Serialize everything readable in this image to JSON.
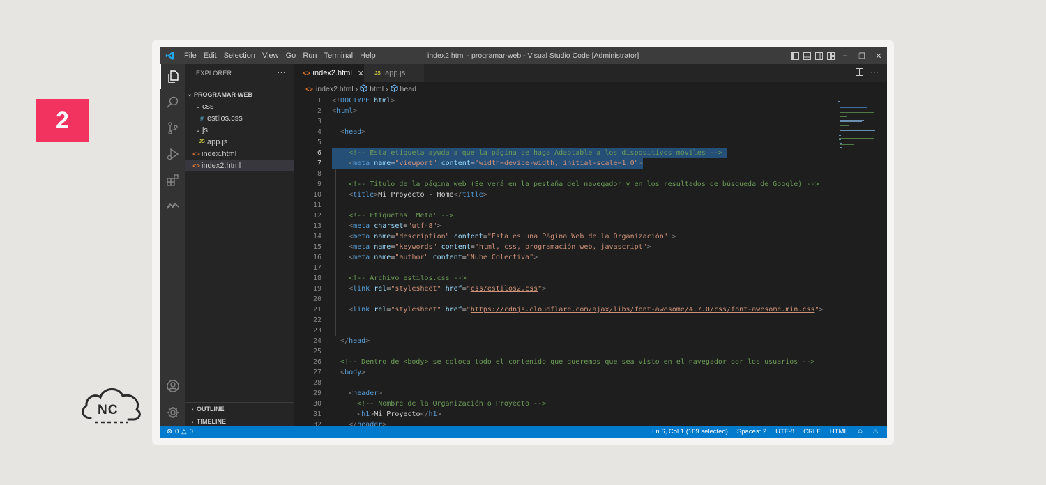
{
  "badge": "2",
  "logo_text": "NC",
  "window": {
    "title": "index2.html - programar-web - Visual Studio Code [Administrator]",
    "menu": [
      "File",
      "Edit",
      "Selection",
      "View",
      "Go",
      "Run",
      "Terminal",
      "Help"
    ]
  },
  "sidebar": {
    "header": "EXPLORER",
    "project": "PROGRAMAR-WEB",
    "folders": {
      "css": "css",
      "css_file": "estilos.css",
      "js": "js",
      "js_file": "app.js",
      "file1": "index.html",
      "file2": "index2.html"
    },
    "outline": "OUTLINE",
    "timeline": "TIMELINE",
    "icons": {
      "css": "#",
      "js": "JS",
      "html": "<>"
    }
  },
  "tabs": [
    {
      "label": "index2.html",
      "icon": "html-file-icon",
      "active": true
    },
    {
      "label": "app.js",
      "icon": "js-file-icon",
      "active": false
    }
  ],
  "breadcrumb": [
    "index2.html",
    "html",
    "head"
  ],
  "editor": {
    "lines": [
      {
        "n": "1",
        "html": "<span class='t-br'>&lt;!</span><span class='t-tag'>DOCTYPE</span> <span class='t-attr'>html</span><span class='t-br'>&gt;</span>"
      },
      {
        "n": "2",
        "html": "<span class='t-br'>&lt;</span><span class='t-tag'>html</span><span class='t-br'>&gt;</span>"
      },
      {
        "n": "3",
        "html": ""
      },
      {
        "n": "4",
        "html": "  <span class='t-br'>&lt;</span><span class='t-tag'>head</span><span class='t-br'>&gt;</span>"
      },
      {
        "n": "5",
        "html": ""
      },
      {
        "n": "6",
        "html": "    <span class='t-cm'>&lt;!-- Esta etiqueta ayuda a que la página se haga Adaptable a los dispositivos móviles --&gt;</span>"
      },
      {
        "n": "7",
        "html": "    <span class='t-br'>&lt;</span><span class='t-tag'>meta</span> <span class='t-attr'>name</span><span class='t-txt'>=</span><span class='t-str'>\"viewport\"</span> <span class='t-attr'>content</span><span class='t-txt'>=</span><span class='t-str'>\"width=device-width, initial-scale=1.0\"</span><span class='t-br'>&gt;</span>"
      },
      {
        "n": "8",
        "html": ""
      },
      {
        "n": "9",
        "html": "    <span class='t-cm'>&lt;!-- Titulo de la página web (Se verá en la pestaña del navegador y en los resultados de búsqueda de Google) --&gt;</span>"
      },
      {
        "n": "10",
        "html": "    <span class='t-br'>&lt;</span><span class='t-tag'>title</span><span class='t-br'>&gt;</span><span class='t-txt'>Mi Proyecto - Home</span><span class='t-br'>&lt;/</span><span class='t-tag'>title</span><span class='t-br'>&gt;</span>"
      },
      {
        "n": "11",
        "html": ""
      },
      {
        "n": "12",
        "html": "    <span class='t-cm'>&lt;!-- Etiquetas 'Meta' --&gt;</span>"
      },
      {
        "n": "13",
        "html": "    <span class='t-br'>&lt;</span><span class='t-tag'>meta</span> <span class='t-attr'>charset</span><span class='t-txt'>=</span><span class='t-str'>\"utf-8\"</span><span class='t-br'>&gt;</span>"
      },
      {
        "n": "14",
        "html": "    <span class='t-br'>&lt;</span><span class='t-tag'>meta</span> <span class='t-attr'>name</span><span class='t-txt'>=</span><span class='t-str'>\"description\"</span> <span class='t-attr'>content</span><span class='t-txt'>=</span><span class='t-str'>\"Esta es una Página Web de la Organización\"</span> <span class='t-br'>&gt;</span>"
      },
      {
        "n": "15",
        "html": "    <span class='t-br'>&lt;</span><span class='t-tag'>meta</span> <span class='t-attr'>name</span><span class='t-txt'>=</span><span class='t-str'>\"keywords\"</span> <span class='t-attr'>content</span><span class='t-txt'>=</span><span class='t-str'>\"html, css, programación web, javascript\"</span><span class='t-br'>&gt;</span>"
      },
      {
        "n": "16",
        "html": "    <span class='t-br'>&lt;</span><span class='t-tag'>meta</span> <span class='t-attr'>name</span><span class='t-txt'>=</span><span class='t-str'>\"author\"</span> <span class='t-attr'>content</span><span class='t-txt'>=</span><span class='t-str'>\"Nube Colectiva\"</span><span class='t-br'>&gt;</span>"
      },
      {
        "n": "17",
        "html": ""
      },
      {
        "n": "18",
        "html": "    <span class='t-cm'>&lt;!-- Archivo estilos.css --&gt;</span>"
      },
      {
        "n": "19",
        "html": "    <span class='t-br'>&lt;</span><span class='t-tag'>link</span> <span class='t-attr'>rel</span><span class='t-txt'>=</span><span class='t-str'>\"stylesheet\"</span> <span class='t-attr'>href</span><span class='t-txt'>=</span><span class='t-str'>\"</span><span class='t-link'>css/estilos2.css</span><span class='t-str'>\"</span><span class='t-br'>&gt;</span>"
      },
      {
        "n": "20",
        "html": ""
      },
      {
        "n": "21",
        "html": "    <span class='t-br'>&lt;</span><span class='t-tag'>link</span> <span class='t-attr'>rel</span><span class='t-txt'>=</span><span class='t-str'>\"stylesheet\"</span> <span class='t-attr'>href</span><span class='t-txt'>=</span><span class='t-str'>\"</span><span class='t-link'>https://cdnjs.cloudflare.com/ajax/libs/font-awesome/4.7.0/css/font-awesome.min.css</span><span class='t-str'>\"</span><span class='t-br'>&gt;</span>"
      },
      {
        "n": "22",
        "html": ""
      },
      {
        "n": "23",
        "html": ""
      },
      {
        "n": "24",
        "html": "  <span class='t-br'>&lt;/</span><span class='t-tag'>head</span><span class='t-br'>&gt;</span>"
      },
      {
        "n": "25",
        "html": ""
      },
      {
        "n": "26",
        "html": "  <span class='t-cm'>&lt;!-- Dentro de &lt;body&gt; se coloca todo el contenido que queremos que sea visto en el navegador por los usuarios --&gt;</span>"
      },
      {
        "n": "27",
        "html": "  <span class='t-br'>&lt;</span><span class='t-tag'>body</span><span class='t-br'>&gt;</span>"
      },
      {
        "n": "28",
        "html": ""
      },
      {
        "n": "29",
        "html": "    <span class='t-br'>&lt;</span><span class='t-tag'>header</span><span class='t-br'>&gt;</span>"
      },
      {
        "n": "30",
        "html": "      <span class='t-cm'>&lt;!-- Nombre de la Organización o Proyecto --&gt;</span>"
      },
      {
        "n": "31",
        "html": "      <span class='t-br'>&lt;</span><span class='t-tag'>h1</span><span class='t-br'>&gt;</span><span class='t-txt'>Mi Proyecto</span><span class='t-br'>&lt;/</span><span class='t-tag'>h1</span><span class='t-br'>&gt;</span>"
      },
      {
        "n": "32",
        "html": "    <span class='t-br'>&lt;/</span><span class='t-tag'>header</span><span class='t-br'>&gt;</span>"
      }
    ]
  },
  "status": {
    "errors": "0",
    "warnings": "0",
    "position": "Ln 6, Col 1 (169 selected)",
    "spaces": "Spaces: 2",
    "encoding": "UTF-8",
    "eol": "CRLF",
    "language": "HTML"
  },
  "colors": {
    "badge": "#f2325f",
    "status_bar": "#007acc",
    "selection": "#264f78"
  }
}
